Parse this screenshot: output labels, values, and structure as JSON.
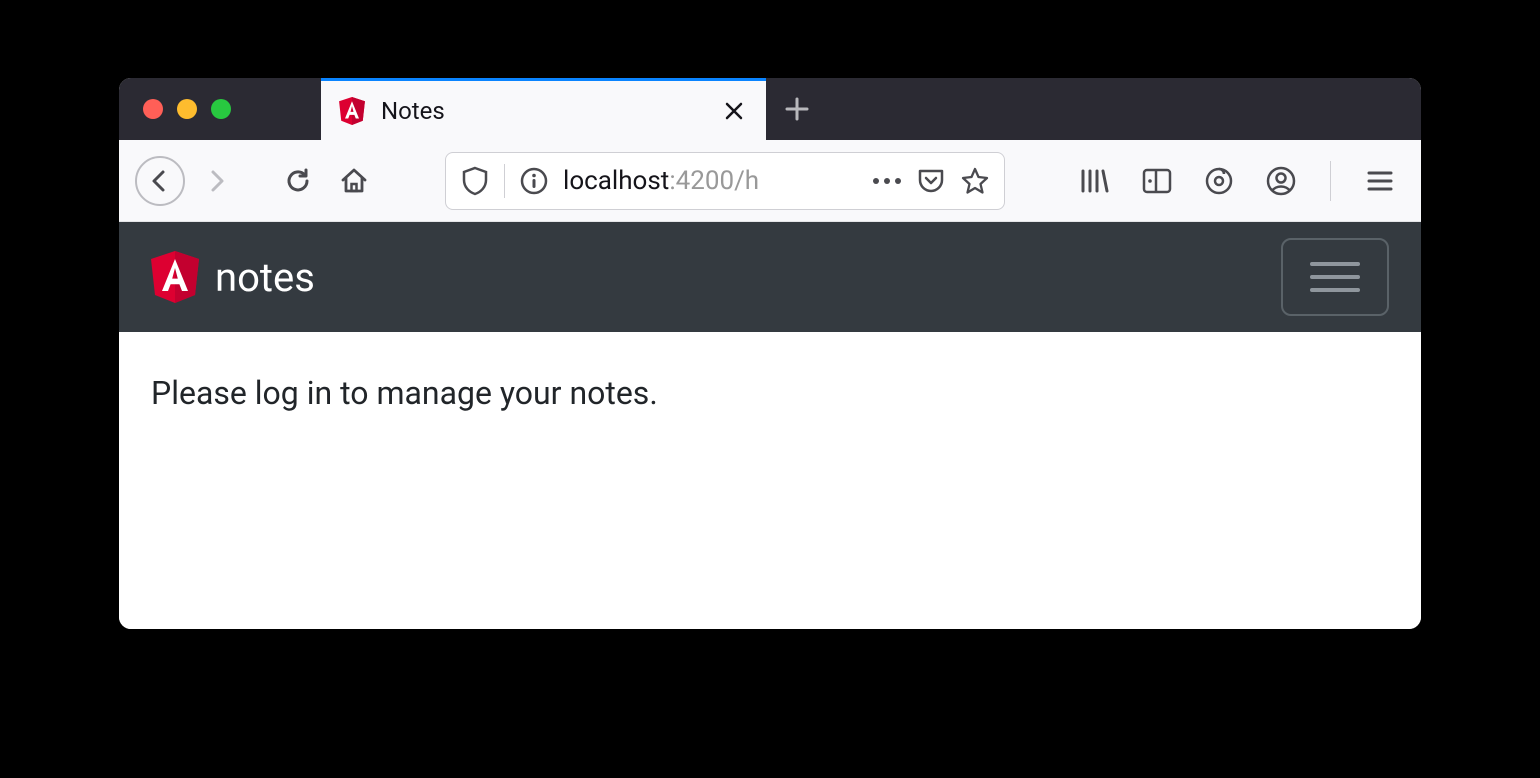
{
  "browser": {
    "tab": {
      "title": "Notes"
    },
    "url": {
      "host": "localhost",
      "port": ":4200",
      "rest": "/h"
    }
  },
  "app": {
    "brand": "notes",
    "message": "Please log in to manage your notes."
  }
}
